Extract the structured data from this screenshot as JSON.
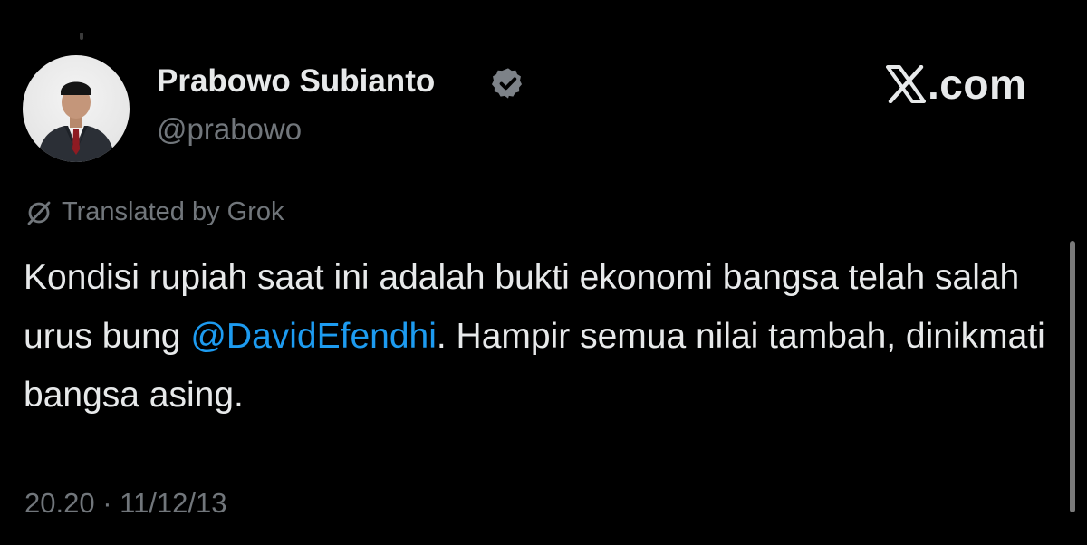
{
  "author": {
    "name": "Prabowo Subianto",
    "handle": "@prabowo",
    "verified_icon": "verified-badge-icon"
  },
  "brand": {
    "logo_icon": "x-logo-icon",
    "text": ".com"
  },
  "translation": {
    "icon": "grok-icon",
    "label": "Translated by Grok"
  },
  "tweet": {
    "text_before": "Kondisi rupiah saat ini adalah bukti ekonomi bangsa telah salah urus bung ",
    "mention": "@DavidEfendhi",
    "text_after": ". Hampir semua nilai tambah, dinikmati bangsa asing."
  },
  "timestamp": "20.20 · 11/12/13",
  "colors": {
    "background": "#000000",
    "text_primary": "#e7e9ea",
    "text_secondary": "#71767b",
    "mention": "#1d9bf0"
  }
}
